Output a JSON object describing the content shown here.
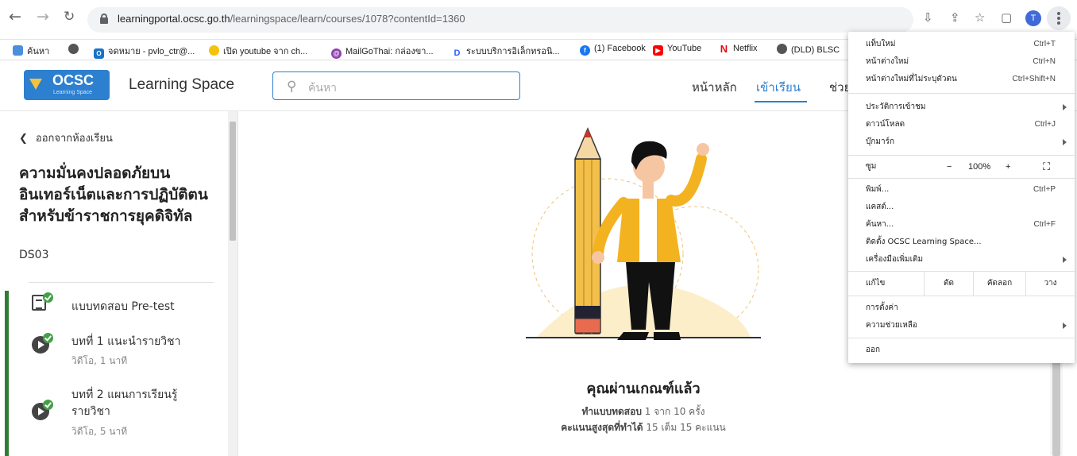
{
  "browser": {
    "url_host": "learningportal.ocsc.go.th",
    "url_path": "/learningspace/learn/courses/1078?contentId=1360",
    "profile_initial": "T",
    "icons": [
      "back-arrow-icon",
      "forward-arrow-icon",
      "reload-icon",
      "lock-icon",
      "install-icon",
      "share-icon",
      "star-icon",
      "sidepanel-icon",
      "kebab-icon"
    ]
  },
  "bookmarks": [
    {
      "label": "ค้นหา",
      "icon": "app-grid-icon"
    },
    {
      "label": "",
      "icon": "globe-icon"
    },
    {
      "label": "จดหมาย - pvlo_ctr@...",
      "icon": "outlook-icon"
    },
    {
      "label": "เปิด youtube จาก ch...",
      "icon": "emoji-icon"
    },
    {
      "label": "MailGoThai: กล่องขา...",
      "icon": "mailgothai-icon"
    },
    {
      "label": "ระบบบริการอิเล็กทรอนิ...",
      "icon": "d-icon"
    },
    {
      "label": "(1) Facebook",
      "icon": "facebook-icon"
    },
    {
      "label": "YouTube",
      "icon": "youtube-icon"
    },
    {
      "label": "Netflix",
      "icon": "netflix-icon"
    },
    {
      "label": "(DLD) BLSC",
      "icon": "globe-icon"
    }
  ],
  "header": {
    "logo_text": "OCSC",
    "logo_sub": "Learning Space",
    "brand": "Learning Space",
    "search_placeholder": "ค้นหา",
    "nav": [
      "หน้าหลัก",
      "เข้าเรียน",
      "ช่วย"
    ]
  },
  "sidebar": {
    "back_label": "ออกจากห้องเรียน",
    "course_title": "ความมั่นคงปลอดภัยบนอินเทอร์เน็ตและการปฏิบัติตนสำหรับข้าราชการยุคดิจิทัล",
    "course_code": "DS03",
    "lessons": [
      {
        "title": "แบบทดสอบ Pre-test",
        "meta": "",
        "icon": "quiz-doc-icon"
      },
      {
        "title": "บทที่ 1 แนะนำรายวิชา",
        "meta": "วิดีโอ, 1 นาที",
        "icon": "play-icon"
      },
      {
        "title": "บทที่ 2 แผนการเรียนรู้รายวิชา",
        "meta": "วิดีโอ, 5 นาที",
        "icon": "play-icon"
      }
    ]
  },
  "result": {
    "title": "คุณผ่านเกณฑ์แล้ว",
    "attempts_label": "ทำแบบทดสอบ",
    "attempts_value": "1 จาก 10 ครั้ง",
    "score_label": "คะแนนสูงสุดที่ทำได้",
    "score_value": "15 เต็ม 15 คะแนน"
  },
  "menu": {
    "new_tab": "แท็บใหม่",
    "new_tab_sc": "Ctrl+T",
    "new_window": "หน้าต่างใหม่",
    "new_window_sc": "Ctrl+N",
    "incognito": "หน้าต่างใหม่ที่ไม่ระบุตัวตน",
    "incognito_sc": "Ctrl+Shift+N",
    "history": "ประวัติการเข้าชม",
    "downloads": "ดาวน์โหลด",
    "downloads_sc": "Ctrl+J",
    "bookmarks": "บุ๊กมาร์ก",
    "zoom_label": "ซูม",
    "zoom_minus": "−",
    "zoom_value": "100%",
    "zoom_plus": "+",
    "print": "พิมพ์...",
    "print_sc": "Ctrl+P",
    "cast": "แคสต์...",
    "find": "ค้นหา...",
    "find_sc": "Ctrl+F",
    "install": "ติดตั้ง OCSC Learning Space...",
    "more_tools": "เครื่องมือเพิ่มเติม",
    "edit": "แก้ไข",
    "cut": "ตัด",
    "copy": "คัดลอก",
    "paste": "วาง",
    "settings": "การตั้งค่า",
    "help": "ความช่วยเหลือ",
    "exit": "ออก"
  }
}
